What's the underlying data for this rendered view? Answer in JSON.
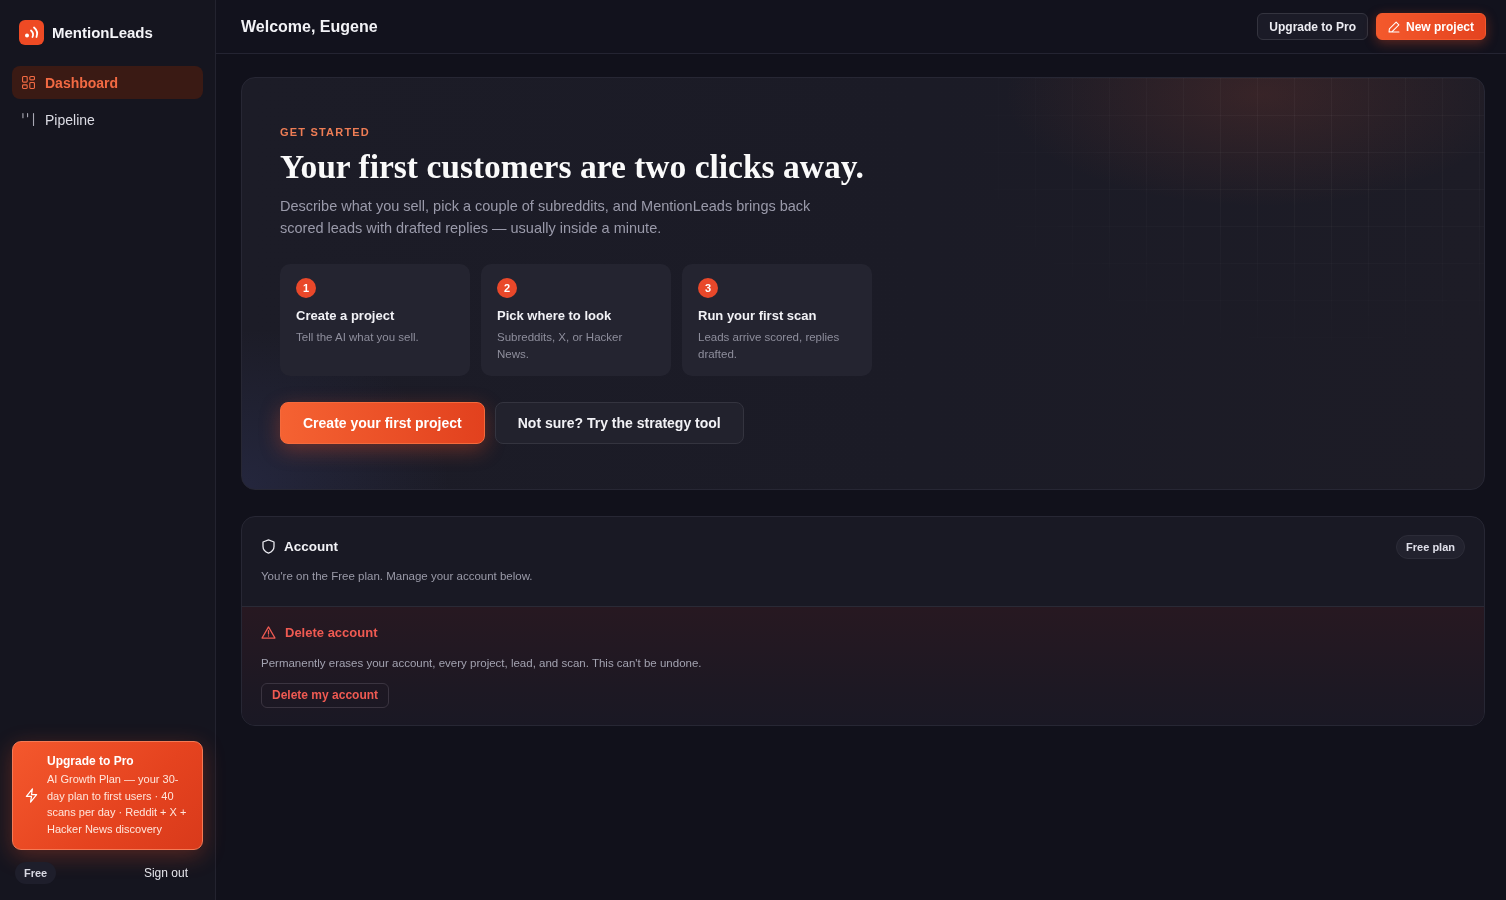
{
  "sidebar": {
    "brand": "MentionLeads",
    "nav": [
      {
        "label": "Dashboard",
        "kind": "dashboard",
        "selected": true
      },
      {
        "label": "Pipeline",
        "kind": "pipeline",
        "selected": false
      }
    ],
    "upgrade_card": {
      "title": "Upgrade to Pro",
      "description": "AI Growth Plan — your 30-day plan to first users · 40 scans per day · Reddit + X + Hacker News discovery"
    },
    "plan_badge": "Free",
    "sign_out": "Sign out"
  },
  "header": {
    "title": "Welcome, Eugene",
    "buttons": [
      {
        "label": "Upgrade to Pro",
        "kind": "secondary"
      },
      {
        "label": "New project",
        "kind": "primary"
      }
    ]
  },
  "hero": {
    "eyebrow": "GET STARTED",
    "title": "Your first customers are two clicks away.",
    "description": "Describe what you sell, pick a couple of subreddits, and MentionLeads brings back scored leads with drafted replies — usually inside a minute.",
    "steps": [
      {
        "number": "1",
        "title": "Create a project",
        "description": "Tell the AI what you sell."
      },
      {
        "number": "2",
        "title": "Pick where to look",
        "description": "Subreddits, X, or Hacker News."
      },
      {
        "number": "3",
        "title": "Run your first scan",
        "description": "Leads arrive scored, replies drafted."
      }
    ],
    "buttons": [
      {
        "label": "Create your first project",
        "kind": "primary"
      },
      {
        "label": "Not sure? Try the strategy tool",
        "kind": "secondary"
      }
    ]
  },
  "account": {
    "title": "Account",
    "badge": "Free plan",
    "description": "You're on the Free plan. Manage your account below.",
    "danger_zone": {
      "title": "Delete account",
      "description": "Permanently erases your account, every project, lead, and scan. This can't be undone.",
      "button": "Delete my account"
    }
  }
}
